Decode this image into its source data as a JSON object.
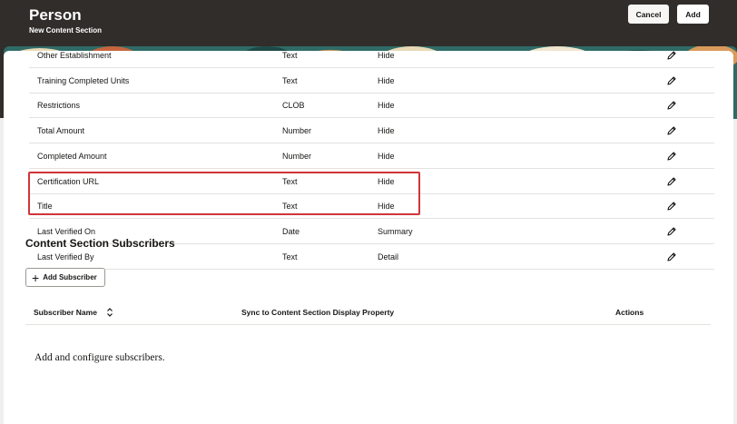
{
  "header": {
    "title": "Person",
    "subtitle": "New Content Section",
    "cancel_label": "Cancel",
    "add_label": "Add"
  },
  "table": {
    "rows": [
      {
        "name": "Other Establishment",
        "type": "Text",
        "display": "Hide"
      },
      {
        "name": "Training Completed Units",
        "type": "Text",
        "display": "Hide"
      },
      {
        "name": "Restrictions",
        "type": "CLOB",
        "display": "Hide"
      },
      {
        "name": "Total Amount",
        "type": "Number",
        "display": "Hide"
      },
      {
        "name": "Completed Amount",
        "type": "Number",
        "display": "Hide"
      },
      {
        "name": "Certification URL",
        "type": "Text",
        "display": "Hide"
      },
      {
        "name": "Title",
        "type": "Text",
        "display": "Hide"
      },
      {
        "name": "Last Verified On",
        "type": "Date",
        "display": "Summary"
      },
      {
        "name": "Last Verified By",
        "type": "Text",
        "display": "Detail"
      }
    ],
    "edit_icon": "pencil-icon"
  },
  "subscribers": {
    "section_title": "Content Section Subscribers",
    "add_button_label": "Add Subscriber",
    "columns": [
      "Subscriber Name",
      "Sync to Content Section Display Property",
      "Actions"
    ],
    "empty_message": "Add and configure subscribers."
  },
  "colors": {
    "header_bg": "#312d2a",
    "highlight_border": "#d0353a"
  }
}
